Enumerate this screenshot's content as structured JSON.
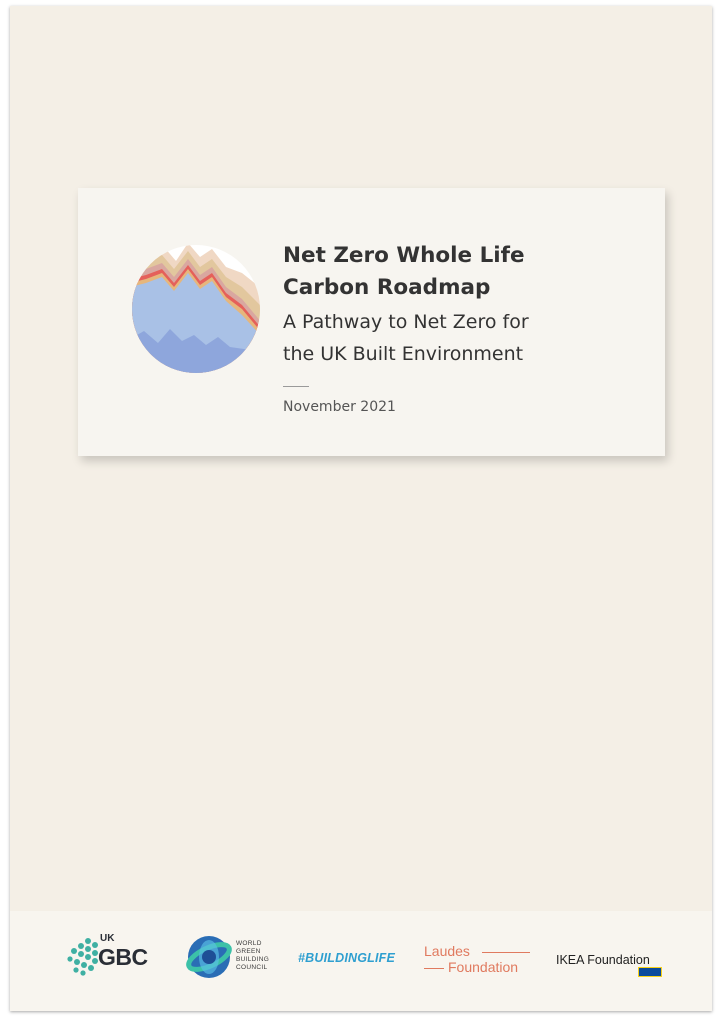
{
  "title_lines": [
    "Net Zero Whole Life",
    "Carbon Roadmap"
  ],
  "subtitle_lines": [
    "A Pathway to Net Zero for",
    "the UK Built Environment"
  ],
  "date": "November 2021",
  "footer_logos": {
    "ukgbc": {
      "small": "UK",
      "large": "GBC"
    },
    "wgbc": {
      "lines": [
        "WORLD",
        "GREEN",
        "BUILDING",
        "COUNCIL"
      ]
    },
    "hashtag": "#BUILDINGLIFE",
    "laudes": {
      "line1": "Laudes",
      "line2": "Foundation"
    },
    "ikea": {
      "name": "IKEA Foundation"
    }
  },
  "colors": {
    "page_background": "#f4efe6",
    "card_background": "#f7f5f0",
    "title_text": "#333333",
    "hashtag_blue": "#2e9fd0",
    "laudes_coral": "#e07a5f"
  },
  "icons": {
    "graphic": "stacked-area-circle-graphic",
    "ukgbc": "ukgbc-dot-logo",
    "wgbc": "globe-ring-logo",
    "ikea": "ikea-badge"
  }
}
